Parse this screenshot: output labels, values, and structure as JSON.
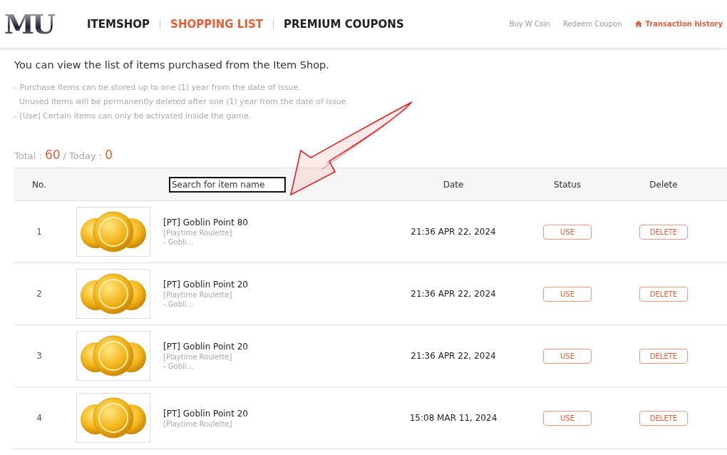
{
  "header": {
    "logo": "MU",
    "nav": [
      {
        "label": "ITEMSHOP",
        "selected": false
      },
      {
        "label": "SHOPPING LIST",
        "selected": true
      },
      {
        "label": "PREMIUM COUPONS",
        "selected": false
      }
    ],
    "links": [
      "Buy W Coin",
      "Redeem Coupon"
    ],
    "history_link": "Transaction history"
  },
  "intro": "You can view the list of items purchased from the Item Shop.",
  "notes": [
    "- Purchase items can be stored up to one (1) year from the date of issue.",
    "  Unused items will be permanently deleted after one (1) year from the date of issue.",
    "- [Use] Certain items can only be activated inside the game."
  ],
  "totals": {
    "total_label": "Total :",
    "total": "60",
    "today_label": "/ Today :",
    "today": "0"
  },
  "table": {
    "columns": [
      "No.",
      "Date",
      "Status",
      "Delete"
    ],
    "search": {
      "placeholder": "Search for item name"
    },
    "rows": [
      {
        "no": "1",
        "name": "[PT] Goblin Point 80",
        "category": "[Playtime Roulette]",
        "desc": "- Gobli...",
        "date": "21:36 APR 22, 2024",
        "status": "USE",
        "delete": "DELETE"
      },
      {
        "no": "2",
        "name": "[PT] Goblin Point 20",
        "category": "[Playtime Roulette]",
        "desc": "- Gobli...",
        "date": "21:36 APR 22, 2024",
        "status": "USE",
        "delete": "DELETE"
      },
      {
        "no": "3",
        "name": "[PT] Goblin Point 20",
        "category": "[Playtime Roulette]",
        "desc": "- Gobli...",
        "date": "21:36 APR 22, 2024",
        "status": "USE",
        "delete": "DELETE"
      },
      {
        "no": "4",
        "name": "[PT] Goblin Point 20",
        "category": "[Playtime Roulette]",
        "date": "15:08 MAR 11, 2024",
        "status": "USE",
        "delete": "DELETE"
      }
    ]
  }
}
